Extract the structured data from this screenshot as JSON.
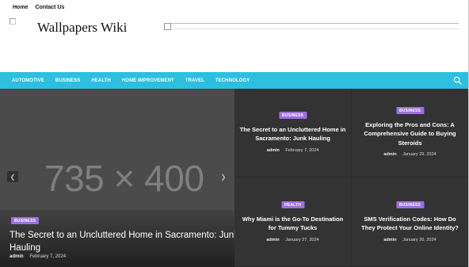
{
  "topbar": {
    "links": [
      "Home",
      "Contact Us"
    ]
  },
  "header": {
    "site_title": "Wallpapers Wiki"
  },
  "nav": {
    "items": [
      "AUTOMOTIVE",
      "BUSINESS",
      "HEALTH",
      "HOME IMPROVEMENT",
      "TRAVEL",
      "TECHNOLOGY"
    ],
    "search_icon": "search-icon"
  },
  "slider": {
    "placeholder": "735 × 400",
    "badge": "BUSINESS",
    "title": "The Secret to an Uncluttered Home in Sacramento: Junk Hauling",
    "author": "admin",
    "date": "February 7, 2024"
  },
  "cards": [
    {
      "badge": "BUSINESS",
      "title": "The Secret to an Uncluttered Home in Sacramento: Junk Hauling",
      "author": "admin",
      "date": "February 7, 2024"
    },
    {
      "badge": "BUSINESS",
      "title": "Exploring the Pros and Cons: A Comprehensive Guide to Buying Steroids",
      "author": "admin",
      "date": "January 29, 2024"
    },
    {
      "badge": "HEALTH",
      "title": "Why Miami is the Go-To Destination for Tummy Tucks",
      "author": "admin",
      "date": "January 27, 2024"
    },
    {
      "badge": "BUSINESS",
      "title": "SMS Verification Codes: How Do They Protect Your Online Identity?",
      "author": "admin",
      "date": "January 26, 2024"
    }
  ],
  "colors": {
    "nav_bg": "#2cbfe0",
    "badge_bg": "#9b6fe0",
    "card_bg": "#333333"
  }
}
